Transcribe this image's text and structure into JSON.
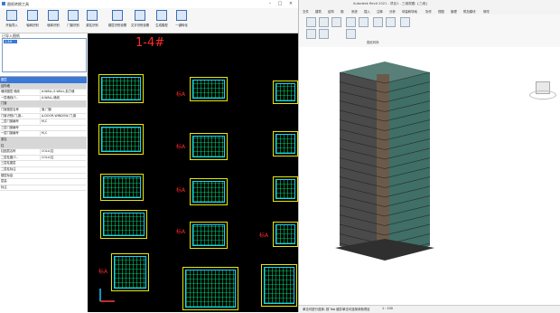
{
  "left_window": {
    "title": "图纸转换工具",
    "toolbar": [
      {
        "label": "开始导入",
        "icon": "import-icon"
      },
      {
        "label": "轴网识别",
        "icon": "grid-icon"
      },
      {
        "label": "墙体识别",
        "icon": "wall-icon"
      },
      {
        "label": "门窗识别",
        "icon": "door-icon"
      },
      {
        "label": "梁柱识别",
        "icon": "beam-icon"
      },
      {
        "label": "楼层识别设置",
        "icon": "floor-settings-icon"
      },
      {
        "label": "文字识别设置",
        "icon": "text-settings-icon"
      },
      {
        "label": "生成模型",
        "icon": "generate-icon"
      },
      {
        "label": "一键转化",
        "icon": "convert-icon"
      }
    ],
    "drawing_panel_label": "已导入图纸",
    "drawing_list_selected": "1-4#",
    "properties": [
      {
        "key": "图层",
        "value": "",
        "type": "sel"
      },
      {
        "key": "结构墙",
        "value": "",
        "type": "cat"
      },
      {
        "key": "墙线图层 墙线",
        "value": "A-WALL,S-WALL,剪力墙"
      },
      {
        "key": "一层墙线(T...",
        "value": "A-WALL,墙线"
      },
      {
        "key": "门窗",
        "value": "",
        "type": "cat"
      },
      {
        "key": "门窗图层名称",
        "value": "窗,门窗"
      },
      {
        "key": "门窗识别(门,窗...",
        "value": "A-DOOR,WINDOW,门,窗"
      },
      {
        "key": "二层门窗编号",
        "value": "M,C"
      },
      {
        "key": "三层门窗编号",
        "value": ""
      },
      {
        "key": "一层门窗编号",
        "value": "M,C"
      },
      {
        "key": "梁柱",
        "value": "",
        "type": "cat"
      },
      {
        "key": "柱",
        "value": "",
        "type": "cat"
      },
      {
        "key": "柱图层名称",
        "value": "COLU,柱"
      },
      {
        "key": "二层柱图(T...",
        "value": "COLU,柱"
      },
      {
        "key": "三层柱图层",
        "value": ""
      },
      {
        "key": "二层柱标注",
        "value": ""
      },
      {
        "key": "楼层标高",
        "value": ""
      },
      {
        "key": "层高",
        "value": ""
      },
      {
        "key": "标注",
        "value": ""
      }
    ],
    "cad_title": "1-4#",
    "cad_marks": [
      "标A",
      "标A",
      "标A",
      "标A",
      "标A",
      "标A"
    ]
  },
  "right_window": {
    "title": "Autodesk Revit 2021 - 项目1 - 三维视图: {三维}",
    "tabs": [
      "文件",
      "建筑",
      "结构",
      "钢",
      "系统",
      "插入",
      "注释",
      "分析",
      "体量和场地",
      "协作",
      "视图",
      "管理",
      "附加模块",
      "修改"
    ],
    "ribbon_group": "图纸转换",
    "status_text": "单击可进行选择; 按 Tab 键并单击可选择其他项目",
    "view_scale": "1 : 100"
  },
  "colors": {
    "cad_background": "#000000",
    "cad_title_red": "#ff2a2a",
    "selection_blue": "#3a78d8",
    "building_teal": "#3f6f66"
  }
}
